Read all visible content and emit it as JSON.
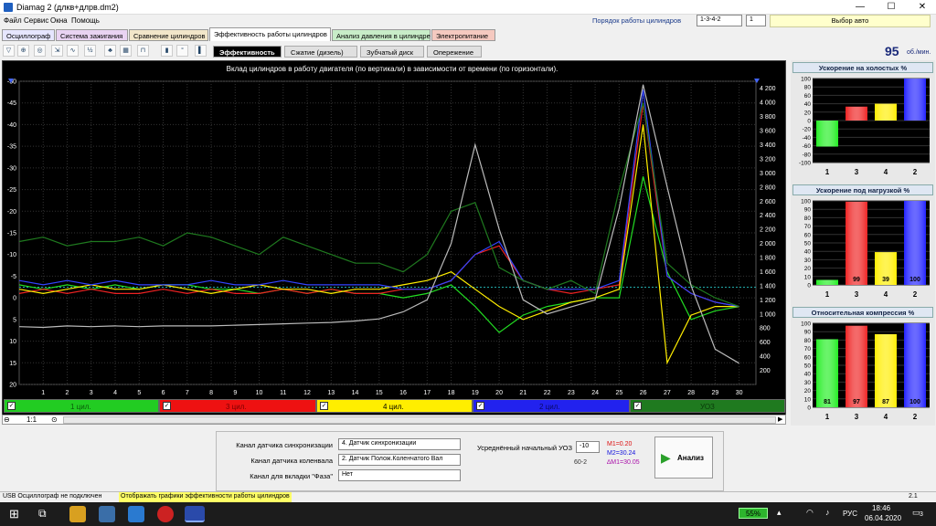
{
  "window": {
    "title": "Diamag 2 (длкв+длрв.dm2)",
    "min": "—",
    "max": "☐",
    "close": "✕"
  },
  "menu": [
    "Файл",
    "Сервис",
    "Окна",
    "Помощь"
  ],
  "header": {
    "firing_order_label": "Порядок работы цилиндров",
    "firing_order": "1-3-4-2",
    "cyl_count": "1",
    "auto_select": "Выбор авто"
  },
  "tabs": [
    {
      "label": "Осциллограф",
      "color": "#e6e6ff"
    },
    {
      "label": "Система зажигания",
      "color": "#e9d3f2"
    },
    {
      "label": "Сравнение цилиндров",
      "color": "#f2e6c9"
    },
    {
      "label": "Эффективность работы цилиндров",
      "color": "#ffffff"
    },
    {
      "label": "Анализ давления в цилиндре",
      "color": "#c8edc8"
    },
    {
      "label": "Электропитание",
      "color": "#f5c9c0"
    }
  ],
  "subtabs": [
    "Эффективность",
    "Сжатие (дизель)",
    "Зубчатый диск",
    "Опережение"
  ],
  "rpm": {
    "value": "95",
    "unit": "об./мин."
  },
  "chart_data": {
    "type": "line",
    "title": "Вклад цилиндров в работу двигателя (по вертикали) в зависимости от времени (по горизонтали).",
    "x": [
      1,
      2,
      3,
      4,
      5,
      6,
      7,
      8,
      9,
      10,
      11,
      12,
      13,
      14,
      15,
      16,
      17,
      18,
      19,
      20,
      21,
      22,
      23,
      24,
      25,
      26,
      27,
      28,
      29,
      30
    ],
    "xlim": [
      0,
      30.7
    ],
    "ylim_left": [
      -50,
      20
    ],
    "yticks_left": [
      "-50",
      "-45",
      "-40",
      "-35",
      "-30",
      "-25",
      "-20",
      "-15",
      "-10",
      "-5",
      "0",
      "5",
      "10",
      "15",
      "20"
    ],
    "ylim_right": [
      0,
      4300
    ],
    "yticks_right": [
      "4 200",
      "4 000",
      "3 800",
      "3 600",
      "3 400",
      "3 200",
      "3 000",
      "2 800",
      "2 600",
      "2 400",
      "2 200",
      "2 000",
      "1 800",
      "1 600",
      "1 400",
      "1 200",
      "1 000",
      "800",
      "600",
      "400",
      "200"
    ],
    "reference_rpm": 1380,
    "series": [
      {
        "name": "1 цил.",
        "color": "#22dd22",
        "values": [
          -3,
          -2,
          -3,
          -2,
          -3,
          -2,
          -3,
          -3,
          -2,
          -2,
          -1,
          -2,
          -1,
          -2,
          -1,
          -1,
          0,
          -1,
          -3,
          2,
          8,
          4,
          2,
          1,
          0,
          0,
          -28,
          -6,
          5,
          3,
          2
        ]
      },
      {
        "name": "3 цил.",
        "color": "#ee2222",
        "values": [
          -1,
          -2,
          -1,
          -2,
          -1,
          -1,
          -2,
          -1,
          -2,
          -1,
          -1,
          -2,
          -1,
          -2,
          -1,
          -1,
          -2,
          -2,
          -4,
          -10,
          -12,
          -4,
          -2,
          -1,
          -2,
          -3,
          -45,
          -5,
          -1,
          1,
          2
        ]
      },
      {
        "name": "4 цил.",
        "color": "#ffee00",
        "values": [
          -2,
          -1,
          -2,
          -3,
          -2,
          -2,
          -3,
          -2,
          -1,
          -2,
          -3,
          -2,
          -2,
          -1,
          -2,
          -2,
          -3,
          -4,
          -6,
          -2,
          2,
          5,
          3,
          1,
          0,
          -2,
          -40,
          15,
          4,
          2,
          2
        ]
      },
      {
        "name": "2 цил.",
        "color": "#3344ff",
        "values": [
          -4,
          -3,
          -4,
          -3,
          -4,
          -3,
          -3,
          -3,
          -4,
          -3,
          -3,
          -4,
          -3,
          -3,
          -3,
          -3,
          -2,
          -2,
          -4,
          -10,
          -13,
          -4,
          -2,
          -2,
          -2,
          -4,
          -48,
          -5,
          -1,
          1,
          2
        ]
      },
      {
        "name": "УОЗ",
        "color": "#1f7a1f",
        "values": [
          -13,
          -14,
          -12,
          -13,
          -13,
          -14,
          -12,
          -15,
          -14,
          -12,
          -10,
          -14,
          -12,
          -10,
          -8,
          -8,
          -6,
          -10,
          -20,
          -22,
          -7,
          -4,
          -2,
          -4,
          -1,
          -25,
          -45,
          -8,
          -3,
          0,
          2
        ]
      },
      {
        "name": "обороты",
        "color": "#bbbbbb",
        "axis": "right",
        "values": [
          820,
          810,
          830,
          820,
          830,
          820,
          830,
          830,
          830,
          840,
          850,
          860,
          870,
          880,
          900,
          930,
          1030,
          1200,
          2000,
          3400,
          2200,
          1200,
          1000,
          1100,
          1200,
          2500,
          4250,
          2800,
          1400,
          500,
          300
        ]
      }
    ]
  },
  "legend": [
    {
      "label": "1 цил.",
      "color": "#22cc22",
      "text": "#0a5a0a"
    },
    {
      "label": "3 цил.",
      "color": "#ee1111",
      "text": "#7a0000"
    },
    {
      "label": "4 цил.",
      "color": "#ffee00",
      "text": "#000000"
    },
    {
      "label": "2 цил.",
      "color": "#2222ee",
      "text": "#0a0a66"
    },
    {
      "label": "УОЗ",
      "color": "#1f7a1f",
      "text": "#0a3a0a"
    }
  ],
  "zoom": "1:1",
  "bar_charts": [
    {
      "title": "Ускорение на холостых %",
      "ylim": [
        -100,
        100
      ],
      "yticks": [
        "100",
        "80",
        "60",
        "40",
        "20",
        "0",
        "-20",
        "-40",
        "-60",
        "-80",
        "-100"
      ],
      "categories": [
        "1",
        "3",
        "4",
        "2"
      ],
      "values": [
        -62,
        33,
        40,
        100
      ],
      "labels": [],
      "colors": [
        "#22ee22",
        "#ee2222",
        "#ffee00",
        "#2222ff"
      ]
    },
    {
      "title": "Ускорение под нагрузкой %",
      "ylim": [
        0,
        100
      ],
      "yticks": [
        "100",
        "90",
        "80",
        "70",
        "60",
        "50",
        "40",
        "30",
        "20",
        "10",
        "0"
      ],
      "categories": [
        "1",
        "3",
        "4",
        "2"
      ],
      "values": [
        6,
        99,
        39,
        100
      ],
      "labels": [
        "",
        "99",
        "39",
        "100"
      ],
      "colors": [
        "#22ee22",
        "#ee2222",
        "#ffee00",
        "#2222ff"
      ]
    },
    {
      "title": "Относительная компрессия %",
      "ylim": [
        0,
        100
      ],
      "yticks": [
        "100",
        "90",
        "80",
        "70",
        "60",
        "50",
        "40",
        "30",
        "20",
        "10",
        "0"
      ],
      "categories": [
        "1",
        "3",
        "4",
        "2"
      ],
      "values": [
        81,
        97,
        87,
        100
      ],
      "labels": [
        "81",
        "97",
        "87",
        "100"
      ],
      "colors": [
        "#22ee22",
        "#ee2222",
        "#ffee00",
        "#2222ff"
      ]
    }
  ],
  "controls": {
    "sync_label": "Канал датчика синхронизации",
    "sync_value": "4.  Датчик синхронизации",
    "crank_label": "Канал датчика коленвала",
    "crank_value": "2.  Датчик Полож.Коленчатого Вал",
    "phase_label": "Канал для вкладки \"Фаза\"",
    "phase_value": "Нет",
    "uoz_label": "Усреднённый начальный УОЗ",
    "uoz_value": "-10",
    "wheel": "60-2",
    "m1": "M1=0.20",
    "m2": "M2=30.24",
    "dm": "∆M1=30.05",
    "analyze": "Анализ"
  },
  "status": {
    "left": "USB Осциллограф не подключен",
    "middle": "Отображать графики эффективности работы цилиндров",
    "right": "2.1"
  },
  "taskbar": {
    "battery": "55%",
    "lang": "РУС",
    "time": "18:46",
    "date": "06.04.2020",
    "notif": "3"
  }
}
